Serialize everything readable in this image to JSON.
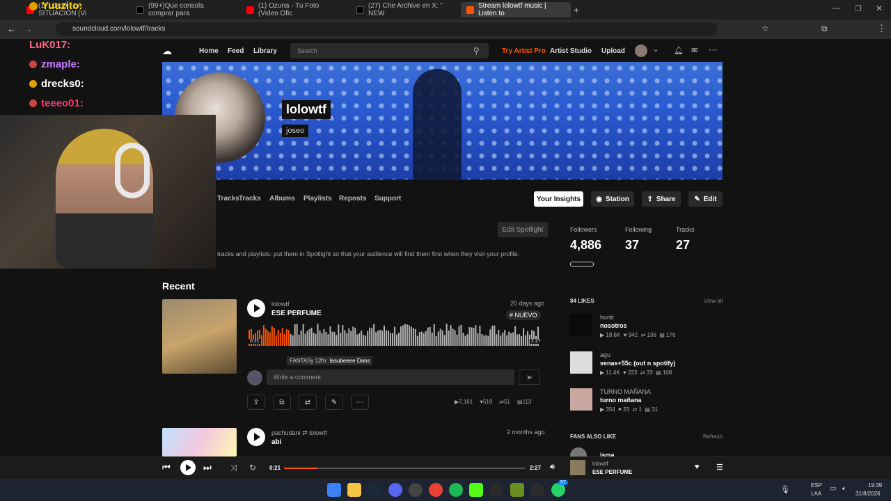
{
  "browser": {
    "tabs": [
      {
        "title": "(1) LOLO - LA SITUACIÓN (Vi",
        "favicon_color": "#ff0000"
      },
      {
        "title": "(99+)Que consola comprar para",
        "favicon_color": "#000000"
      },
      {
        "title": "(1) Ozuna - Tu Foto (Video Ofic",
        "favicon_color": "#ff0000"
      },
      {
        "title": "(27) Che Archive en X: \" NEW",
        "favicon_color": "#000000"
      },
      {
        "title": "Stream lolowtf music | Listen to",
        "favicon_color": "#ff5500"
      }
    ],
    "url": "soundcloud.com/lolowtf/tracks"
  },
  "soundcloud": {
    "nav": {
      "home": "Home",
      "feed": "Feed",
      "library": "Library",
      "search_placeholder": "Search",
      "try_pro": "Try Artist Pro",
      "artist_studio": "Artist Studio",
      "upload": "Upload"
    },
    "profile": {
      "name": "lolowtf",
      "handle": "joseo"
    },
    "tabs": [
      "Tracks",
      "Tracks",
      "Albums",
      "Playlists",
      "Reposts",
      "Support"
    ],
    "buttons": {
      "insights": "Your Insights",
      "station": "Station",
      "share": "Share",
      "edit": "Edit",
      "edit_spotlight": "Edit Spotlight"
    },
    "spotlight_text": "tracks and playlists: put them in Spotlight so that your audience will find them first when they visit your profile.",
    "stats": {
      "followers_label": "Followers",
      "followers": "4,886",
      "following_label": "Following",
      "following": "37",
      "tracks_label": "Tracks",
      "tracks": "27"
    },
    "recent_title": "Recent",
    "track1": {
      "artist": "lolowtf",
      "title": "ESE PERFUME",
      "age": "20 days ago",
      "tag": "# NUEVO",
      "time_start": "0:21",
      "time_end": "2:27",
      "comment_placeholder": "Write a comment",
      "plays": "7,161",
      "likes": "519",
      "reposts": "51",
      "comments": "113",
      "comment_user": "FANTASy 12frr",
      "comment_text": "lasubeeee Dans"
    },
    "track2": {
      "artist": "pachudani",
      "reposter": "lolowtf",
      "title": "abi",
      "age": "2 months ago"
    },
    "likes": {
      "header": "84 LIKES",
      "view_all": "View all",
      "items": [
        {
          "user": "huntr",
          "title": "nosotros",
          "plays": "18.6K",
          "likes": "942",
          "reposts": "136",
          "comments": "176"
        },
        {
          "user": "agu",
          "title": "venas+55c (out n spotify)",
          "plays": "11.4K",
          "likes": "223",
          "reposts": "33",
          "comments": "108"
        },
        {
          "user": "TURNO MAÑANA",
          "title": "turno mañana",
          "plays": "354",
          "likes": "23",
          "reposts": "1",
          "comments": "31"
        }
      ]
    },
    "fans_also_like": {
      "header": "FANS ALSO LIKE",
      "refresh": "Refresh",
      "first_user": "isma"
    }
  },
  "player": {
    "current": "0:21",
    "total": "2:27",
    "artist": "lolowtf",
    "title": "ESE PERFUME",
    "progress": 0.14
  },
  "stream_overlay": {
    "chat": [
      {
        "user": "Yuuzito:",
        "color": "#ffd700"
      },
      {
        "user": "LuK017:",
        "color": "#ff6b8a"
      },
      {
        "user": "zmaple:",
        "color": "#c77dff"
      },
      {
        "user": "drecks0:",
        "color": "#ffffff"
      },
      {
        "user": "teeeo01:",
        "color": "#ff3b6b"
      }
    ]
  },
  "taskbar": {
    "lang": "ESP",
    "lang2": "LAA",
    "time": "19:39",
    "date": "31/8/2026",
    "badge": "57"
  }
}
